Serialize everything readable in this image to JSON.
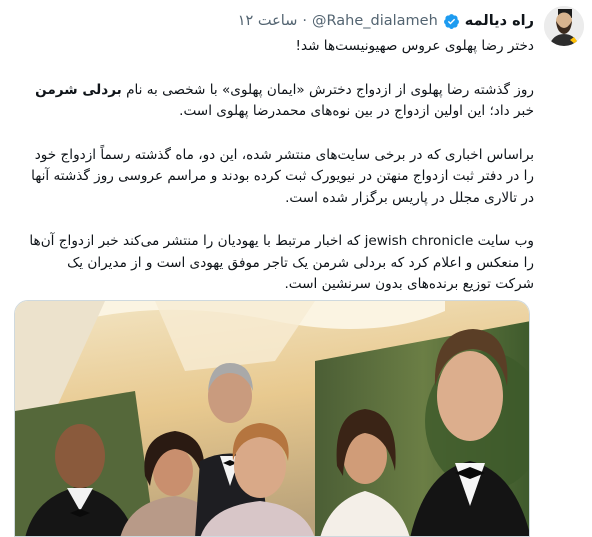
{
  "author": {
    "name": "راه دیالمه",
    "handle": "@Rahe_dialameh",
    "separator": "·",
    "time": "ساعت ۱۲",
    "verified": true,
    "verified_color": "#1d9bf0",
    "avatar_icon": "avatar-portrait-icon"
  },
  "tweet": {
    "headline": "دختر رضا پهلوی عروس صهیونیست‌ها شد!",
    "p1_before": "روز گذشته رضا پهلوی از ازدواج دخترش «ایمان پهلوی» با شخصی به نام ",
    "p1_bold": "بردلی شرمن",
    "p1_after": " خبر داد؛ این اولین ازدواج در بین نوه‌های محمدرضا پهلوی است.",
    "p2": "براساس اخباری که در برخی سایت‌های منتشر شده، این دو، ماه گذشته رسماً ازدواج خود را در دفتر ثبت ازدواج منهتن در نیویورک ثبت کرده بودند و مراسم عروسی روز گذشته آنها در تالاری مجلل در پاریس برگزار شده است.",
    "p3": "وب سایت jewish chronicle که اخبار مرتبط با یهودیان را منتشر می‌کند خبر ازدواج آن‌ها را منعکس و اعلام کرد که بردلی شرمن یک تاجر موفق یهودی است و از مدیران یک شرکت توزیع برنده‌های بدون سرنشین است."
  },
  "media": {
    "type": "photo",
    "subject": "wedding-group-photo"
  }
}
